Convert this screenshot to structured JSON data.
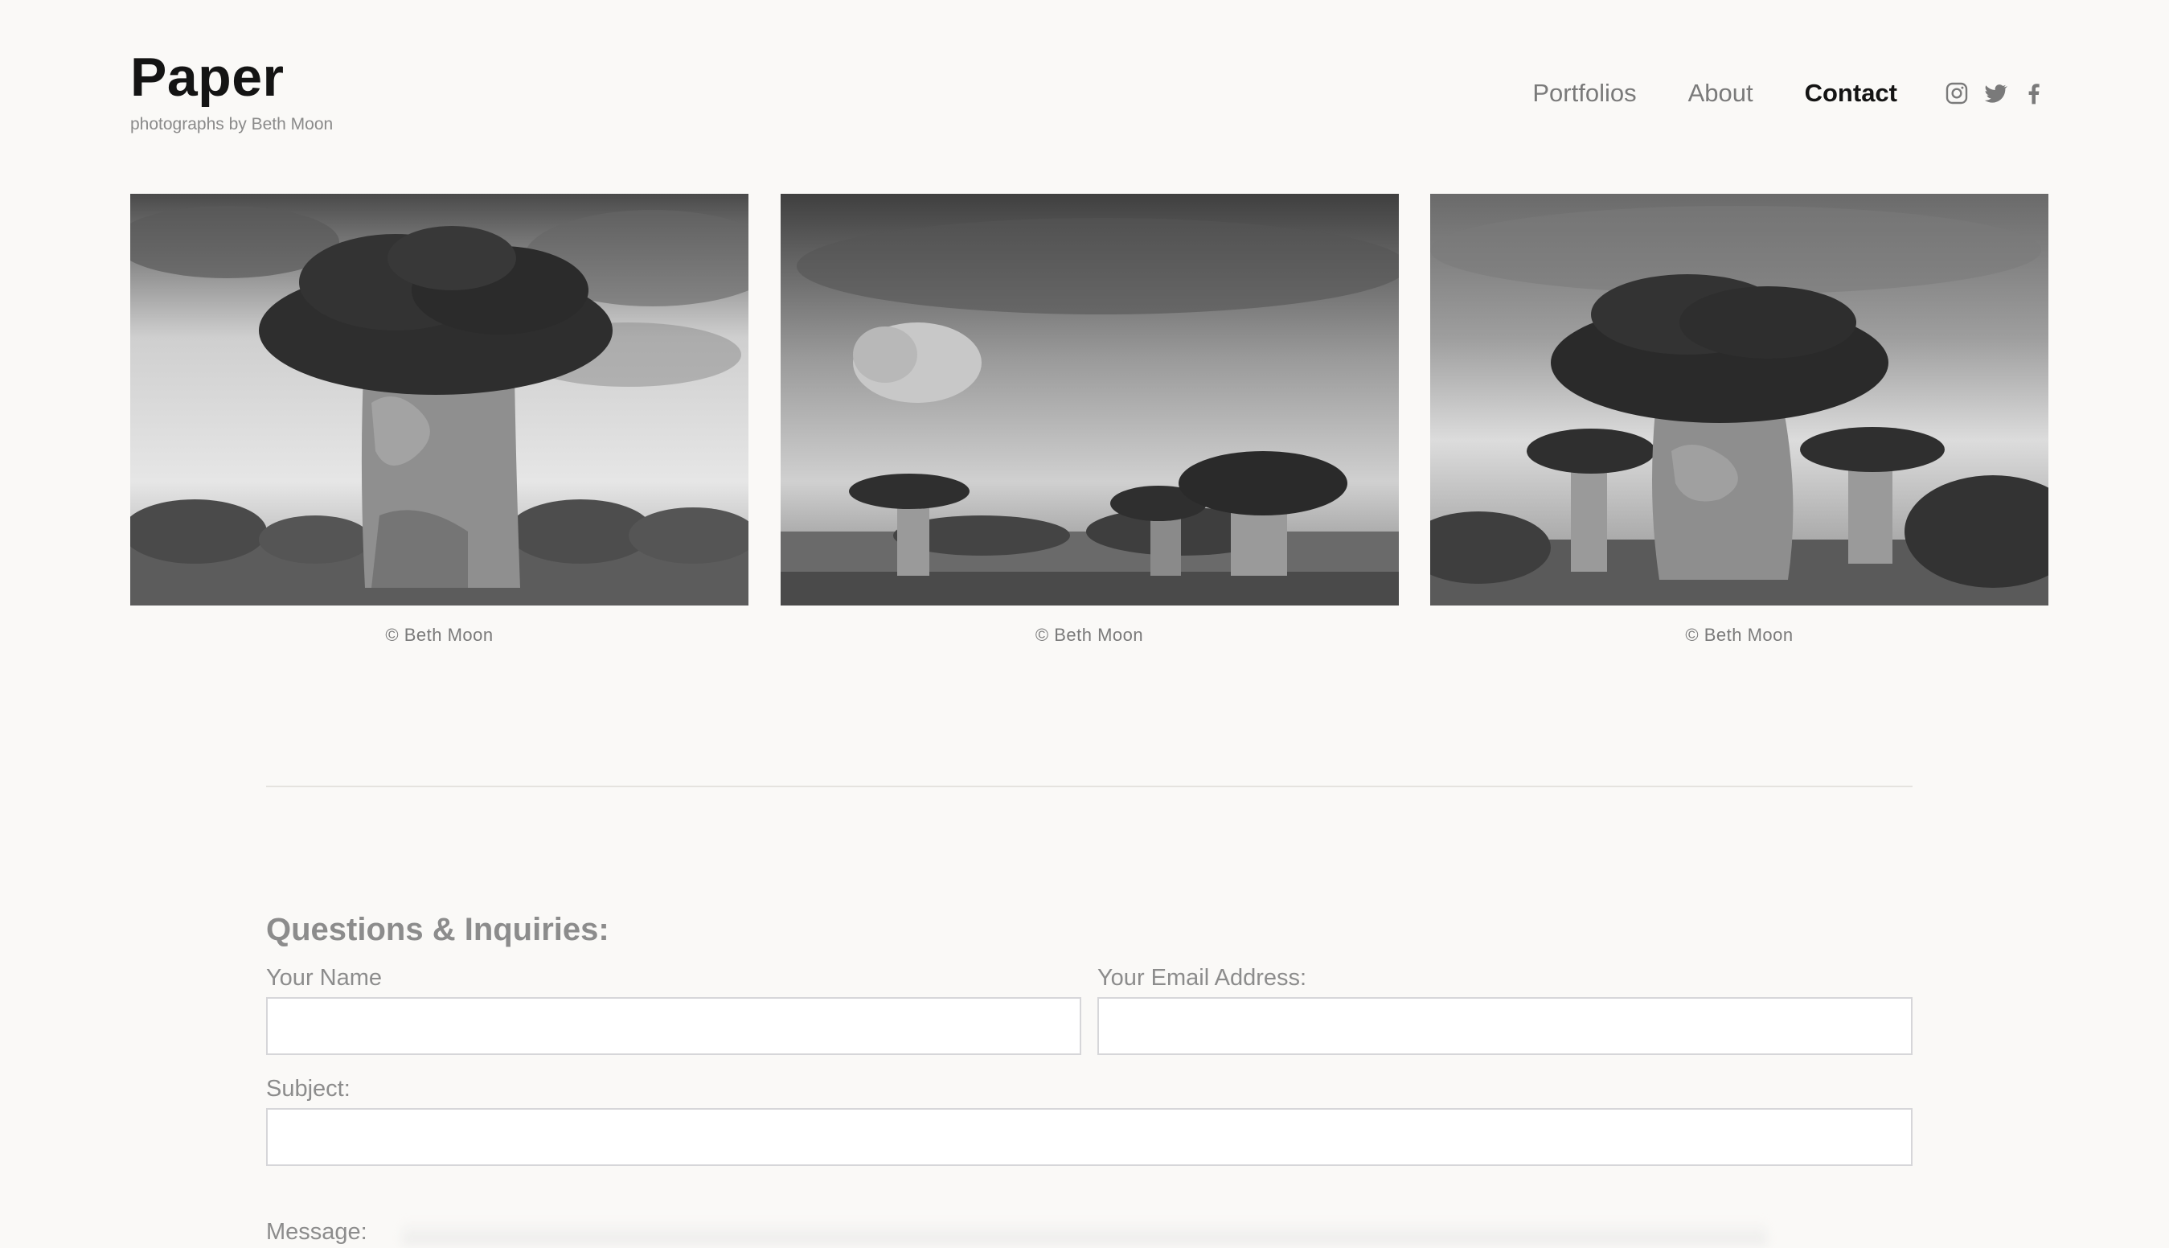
{
  "brand": {
    "title": "Paper",
    "subtitle": "photographs by Beth Moon"
  },
  "nav": {
    "items": [
      {
        "label": "Portfolios",
        "active": false
      },
      {
        "label": "About",
        "active": false
      },
      {
        "label": "Contact",
        "active": true
      }
    ],
    "socials": [
      "instagram-icon",
      "twitter-icon",
      "facebook-icon"
    ]
  },
  "gallery": {
    "items": [
      {
        "caption": "© Beth Moon"
      },
      {
        "caption": "© Beth Moon"
      },
      {
        "caption": "© Beth Moon"
      }
    ]
  },
  "form": {
    "title": "Questions & Inquiries:",
    "name_label": "Your Name",
    "email_label": "Your Email Address:",
    "subject_label": "Subject:",
    "message_label": "Message:",
    "name_value": "",
    "email_value": "",
    "subject_value": ""
  },
  "colors": {
    "background": "#faf9f7",
    "text": "#141414",
    "muted": "#8c8c8c",
    "border": "#d6d6d9"
  }
}
